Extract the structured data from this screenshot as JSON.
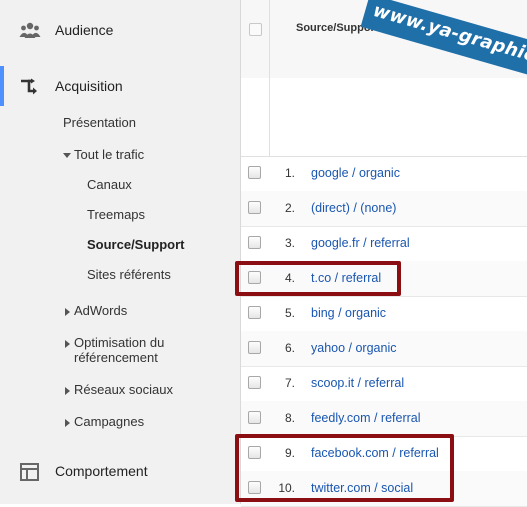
{
  "sidebar": {
    "audience_label": "Audience",
    "acquisition_label": "Acquisition",
    "presentation_label": "Présentation",
    "all_traffic_label": "Tout le trafic",
    "channels_label": "Canaux",
    "treemaps_label": "Treemaps",
    "source_support_label": "Source/Support",
    "referral_sites_label": "Sites référents",
    "adwords_label": "AdWords",
    "seo_label_line1": "Optimisation du",
    "seo_label_line2": "référencement",
    "social_label": "Réseaux sociaux",
    "campaigns_label": "Campagnes",
    "behaviour_label": "Comportement",
    "accent_color": "#4d90fe"
  },
  "table": {
    "column_header": "Source/Support",
    "help_icon": "?",
    "rows": [
      {
        "num": "1.",
        "source": "google / organic"
      },
      {
        "num": "2.",
        "source": "(direct) / (none)"
      },
      {
        "num": "3.",
        "source": "google.fr / referral"
      },
      {
        "num": "4.",
        "source": "t.co / referral"
      },
      {
        "num": "5.",
        "source": "bing / organic"
      },
      {
        "num": "6.",
        "source": "yahoo / organic"
      },
      {
        "num": "7.",
        "source": "scoop.it / referral"
      },
      {
        "num": "8.",
        "source": "feedly.com / referral"
      },
      {
        "num": "9.",
        "source": "facebook.com / referral"
      },
      {
        "num": "10.",
        "source": "twitter.com / social"
      }
    ],
    "link_color": "#1a56b0",
    "highlight_color": "#8b0e12"
  },
  "watermark": {
    "text": "www.ya-graphic.com"
  }
}
